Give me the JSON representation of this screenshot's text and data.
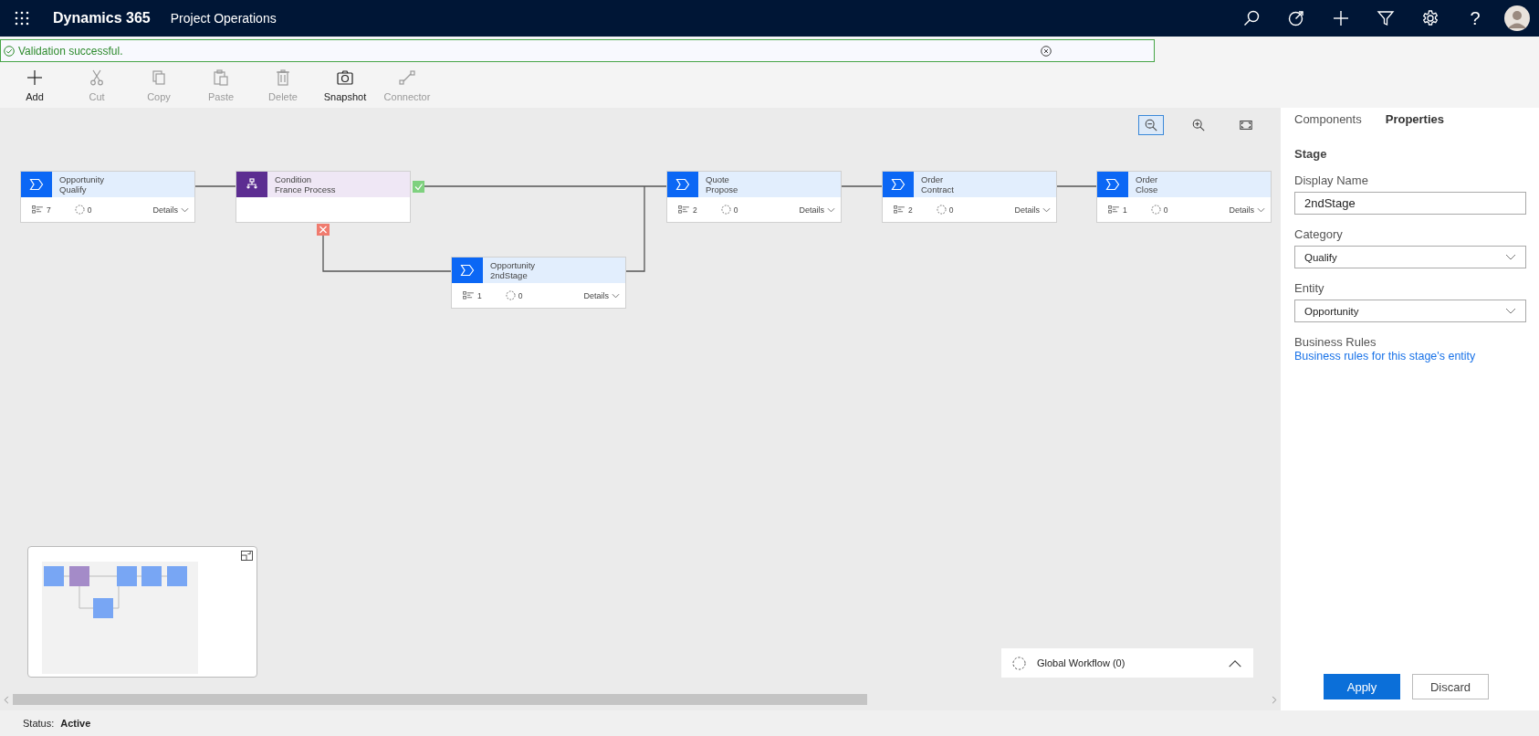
{
  "app_bar": {
    "app_name": "Dynamics 365",
    "area": "Project Operations",
    "help": "?"
  },
  "notification": {
    "message": "Validation successful."
  },
  "toolbar": [
    {
      "kind": "add",
      "label": "Add",
      "disabled": false
    },
    {
      "kind": "cut",
      "label": "Cut",
      "disabled": true
    },
    {
      "kind": "copy",
      "label": "Copy",
      "disabled": true
    },
    {
      "kind": "paste",
      "label": "Paste",
      "disabled": true
    },
    {
      "kind": "delete",
      "label": "Delete",
      "disabled": true
    },
    {
      "kind": "snapshot",
      "label": "Snapshot",
      "disabled": false
    },
    {
      "kind": "connector",
      "label": "Connector",
      "disabled": true
    }
  ],
  "zoom_tools": [
    {
      "kind": "zoom-out",
      "selected": true
    },
    {
      "kind": "zoom-in",
      "selected": false
    },
    {
      "kind": "fit",
      "selected": false
    }
  ],
  "nodes": [
    {
      "kind": "stage",
      "entity": "Opportunity",
      "name": "Qualify",
      "steps": "7",
      "workflows": "0",
      "details": "Details"
    },
    {
      "kind": "condition",
      "entity": "Condition",
      "name": "France Process"
    },
    {
      "kind": "stage",
      "entity": "Quote",
      "name": "Propose",
      "steps": "2",
      "workflows": "0",
      "details": "Details"
    },
    {
      "kind": "stage",
      "entity": "Order",
      "name": "Contract",
      "steps": "2",
      "workflows": "0",
      "details": "Details"
    },
    {
      "kind": "stage",
      "entity": "Order",
      "name": "Close",
      "steps": "1",
      "workflows": "0",
      "details": "Details"
    },
    {
      "kind": "stage",
      "entity": "Opportunity",
      "name": "2ndStage",
      "steps": "1",
      "workflows": "0",
      "details": "Details"
    }
  ],
  "global_workflow": {
    "label": "Global Workflow (0)"
  },
  "panel": {
    "tabs": [
      {
        "label": "Components",
        "selected": false
      },
      {
        "label": "Properties",
        "selected": true
      }
    ],
    "section": "Stage",
    "fields": [
      {
        "kind": "text",
        "label": "Display Name",
        "value": "2ndStage"
      },
      {
        "kind": "select",
        "label": "Category",
        "value": "Qualify"
      },
      {
        "kind": "select",
        "label": "Entity",
        "value": "Opportunity"
      }
    ],
    "business_rules": {
      "label": "Business Rules",
      "link": "Business rules for this stage's entity"
    },
    "buttons": [
      {
        "kind": "primary",
        "label": "Apply"
      },
      {
        "kind": "secondary",
        "label": "Discard"
      }
    ]
  },
  "status": {
    "label": "Status:",
    "value": "Active"
  }
}
